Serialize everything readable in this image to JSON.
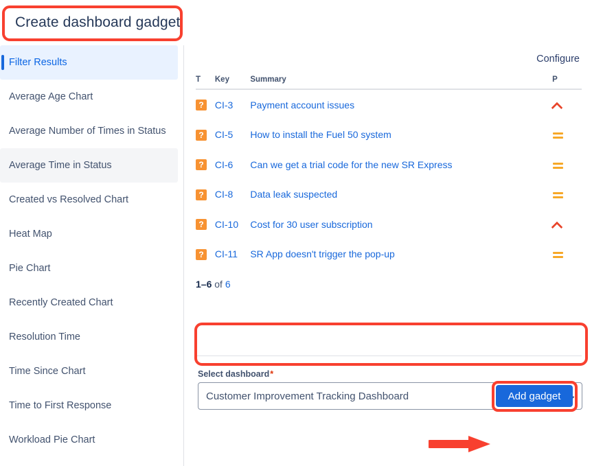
{
  "page": {
    "title": "Create dashboard gadget"
  },
  "sidebar": {
    "items": [
      {
        "label": "Filter Results",
        "state": "selected"
      },
      {
        "label": "Average Age Chart",
        "state": "default"
      },
      {
        "label": "Average Number of Times in Status",
        "state": "default"
      },
      {
        "label": "Average Time in Status",
        "state": "hovered"
      },
      {
        "label": "Created vs Resolved Chart",
        "state": "default"
      },
      {
        "label": "Heat Map",
        "state": "default"
      },
      {
        "label": "Pie Chart",
        "state": "default"
      },
      {
        "label": "Recently Created Chart",
        "state": "default"
      },
      {
        "label": "Resolution Time",
        "state": "default"
      },
      {
        "label": "Time Since Chart",
        "state": "default"
      },
      {
        "label": "Time to First Response",
        "state": "default"
      },
      {
        "label": "Workload Pie Chart",
        "state": "default"
      }
    ]
  },
  "main": {
    "configure_label": "Configure",
    "table": {
      "headers": {
        "type": "T",
        "key": "Key",
        "summary": "Summary",
        "priority": "P"
      },
      "rows": [
        {
          "type_icon": "question-mark-icon",
          "type_glyph": "?",
          "key": "CI-3",
          "summary": "Payment account issues",
          "priority": "high",
          "priority_name": "high-priority-icon"
        },
        {
          "type_icon": "question-mark-icon",
          "type_glyph": "?",
          "key": "CI-5",
          "summary": "How to install the Fuel 50 system",
          "priority": "medium",
          "priority_name": "medium-priority-icon"
        },
        {
          "type_icon": "question-mark-icon",
          "type_glyph": "?",
          "key": "CI-6",
          "summary": "Can we get a trial code for the new SR Express",
          "priority": "medium",
          "priority_name": "medium-priority-icon"
        },
        {
          "type_icon": "question-mark-icon",
          "type_glyph": "?",
          "key": "CI-8",
          "summary": "Data leak suspected",
          "priority": "medium",
          "priority_name": "medium-priority-icon"
        },
        {
          "type_icon": "question-mark-icon",
          "type_glyph": "?",
          "key": "CI-10",
          "summary": "Cost for 30 user subscription",
          "priority": "high",
          "priority_name": "high-priority-icon"
        },
        {
          "type_icon": "question-mark-icon",
          "type_glyph": "?",
          "key": "CI-11",
          "summary": "SR App doesn't trigger the pop-up",
          "priority": "medium",
          "priority_name": "medium-priority-icon"
        }
      ]
    },
    "pagination": {
      "range": "1–6",
      "connector": " of ",
      "total": "6"
    },
    "select_dashboard": {
      "label": "Select dashboard",
      "required_mark": "*",
      "value": "Customer Improvement Tracking Dashboard"
    },
    "add_gadget_label": "Add gadget"
  },
  "colors": {
    "accent_blue": "#1868db",
    "selected_bg": "#e9f2ff",
    "hover_bg": "#f4f5f7",
    "issue_type_orange": "#f79232",
    "priority_high_red": "#e8452b",
    "priority_medium_orange": "#f7a828",
    "annotation_red": "#f8402f",
    "required_red": "#de350b"
  }
}
